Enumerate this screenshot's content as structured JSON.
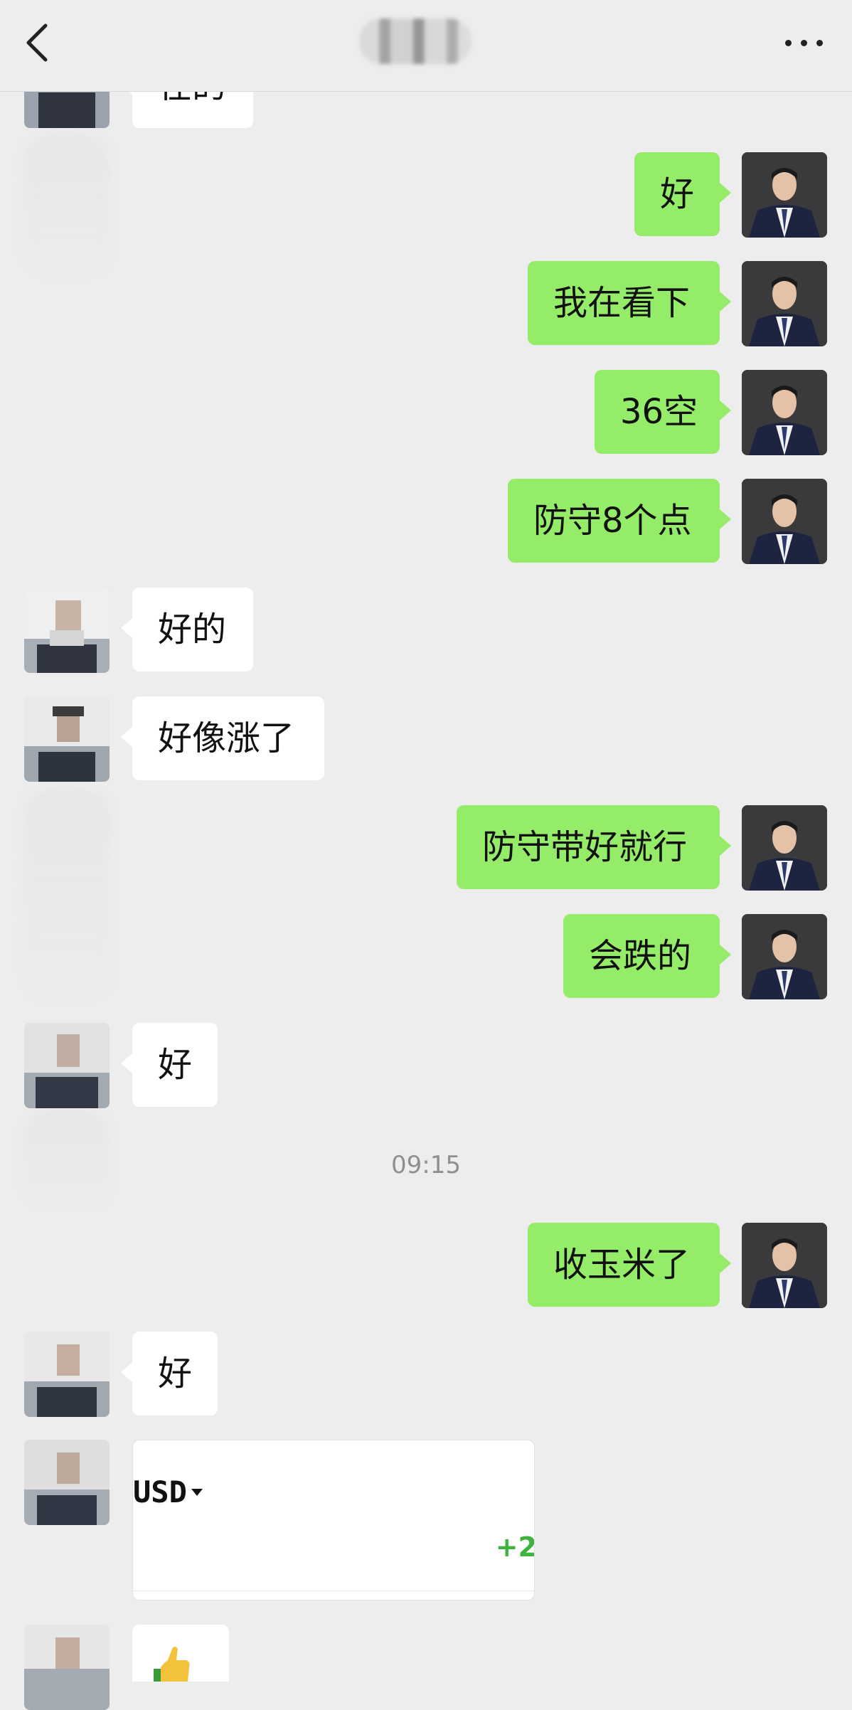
{
  "header": {
    "back_label": "返回",
    "title": "",
    "more_label": "更多"
  },
  "messages": {
    "m0": "在的",
    "m1": "好",
    "m2": "我在看下",
    "m3": "36空",
    "m4": "防守8个点",
    "m5": "好的",
    "m6": "好像涨了",
    "m7": "防守带好就行",
    "m8": "会跌的",
    "m9": "好",
    "timestamp": "09:15",
    "m10": "收玉米了",
    "m11": "好"
  },
  "card": {
    "currency": "USD",
    "change": "+2"
  },
  "icons": {
    "back": "chevron-left-icon",
    "more": "ellipsis-icon",
    "sticker": "thumbs-up-icon"
  },
  "colors": {
    "self_bubble": "#95ec69",
    "other_bubble": "#ffffff",
    "background": "#ededed",
    "positive_change": "#3eb43e"
  }
}
